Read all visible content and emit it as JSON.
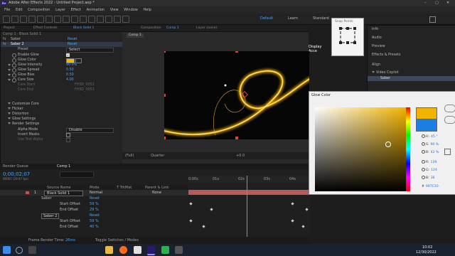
{
  "window": {
    "app_icon": "Ae",
    "title": "Adobe After Effects 2022 - Untitled Project.aep *"
  },
  "menu": [
    "File",
    "Edit",
    "Composition",
    "Layer",
    "Effect",
    "Animation",
    "View",
    "Window",
    "Help"
  ],
  "workspaces": {
    "default": "Default",
    "learn": "Learn",
    "standard": "Standard"
  },
  "snap_popup": {
    "title": "Snap Points"
  },
  "effect_controls": {
    "tabs": {
      "project": "Project",
      "effect_controls": "Effect Controls",
      "layer": "Black Solid 1"
    },
    "comp_path": "Comp 1 · Black Solid 1",
    "reset": "Reset",
    "fx1": "Saber",
    "fx2": "Saber 2",
    "preset_label": "Preset",
    "preset_value": "Select",
    "params": [
      {
        "label": "Enable Glow",
        "value": "✓"
      },
      {
        "label": "Glow Color",
        "value": ""
      },
      {
        "label": "Glow Intensity",
        "value": "90.0%"
      },
      {
        "label": "Glow Spread",
        "value": "0.50"
      },
      {
        "label": "Glow Bias",
        "value": "0.50"
      },
      {
        "label": "Core Size",
        "value": "4.00"
      },
      {
        "label": "Core Start",
        "value": "FHSD_0053"
      },
      {
        "label": "Core End",
        "value": "FHSD_0053"
      }
    ],
    "groups": [
      "Customize Core",
      "Flicker",
      "Distortion",
      "Glow Settings",
      "Render Settings"
    ],
    "alpha_mode_label": "Alpha Mode",
    "alpha_mode_value": "Disable",
    "invert_masks": "Invert Masks",
    "use_text_alpha": "Use Text Alpha"
  },
  "composition": {
    "tabs": {
      "comp": "Composition",
      "comp_name": "Comp 1",
      "layer": "Layer (none)"
    },
    "breadcrumb": "Comp 1",
    "display_accel": "Display Acce",
    "zoom": "(Full)",
    "quality": "Quarter",
    "time": "+0.0"
  },
  "right_panel": {
    "items": [
      "Info",
      "Audio",
      "Preview",
      "Effects & Presets",
      "Align"
    ],
    "video_copilot": "Video Copilot",
    "saber": "Saber"
  },
  "timeline": {
    "render_queue": "Render Queue",
    "tab": "Comp 1",
    "timecode": "0;00;02;07",
    "fps": "00067 (29.97 fps)",
    "columns": {
      "source": "Source Name",
      "mode": "Mode",
      "trkmat": "T TrkMat",
      "parent": "Parent & Link"
    },
    "layer": {
      "num": "1",
      "name": "Black Solid 1",
      "mode": "Normal",
      "parent": "None"
    },
    "rows": [
      {
        "label": "Saber",
        "value": "Reset"
      },
      {
        "label": "Start Offset",
        "value": "59 %"
      },
      {
        "label": "End Offset",
        "value": "29 %"
      },
      {
        "label": "Saber 2",
        "value": "Reset"
      },
      {
        "label": "Start Offset",
        "value": "59 %"
      },
      {
        "label": "End Offset",
        "value": "40 %"
      }
    ],
    "ruler": [
      "0;00s",
      "01s",
      "02s",
      "03s",
      "04s"
    ],
    "frame_render_label": "Frame Render Time:",
    "frame_render_value": "26ms",
    "toggle_label": "Toggle Switches / Modes"
  },
  "color_dialog": {
    "title": "Glow Color",
    "h": {
      "label": "H:",
      "value": "45 °"
    },
    "s": {
      "label": "S:",
      "value": "90 %"
    },
    "b": {
      "label": "B:",
      "value": "42 %"
    },
    "r": {
      "label": "R:",
      "value": "139"
    },
    "g": {
      "label": "G:",
      "value": "124"
    },
    "bl": {
      "label": "B:",
      "value": "36"
    },
    "hex_label": "#",
    "hex": "997C10",
    "new_color": "#f2b400",
    "old_color": "#1a7fe0"
  },
  "taskbar": {
    "time": "10:02",
    "date": "12/30/2022"
  },
  "colors": {
    "accent": "#4aa3ff",
    "layer_bar": "#c85050",
    "gold": "#f2b400"
  }
}
